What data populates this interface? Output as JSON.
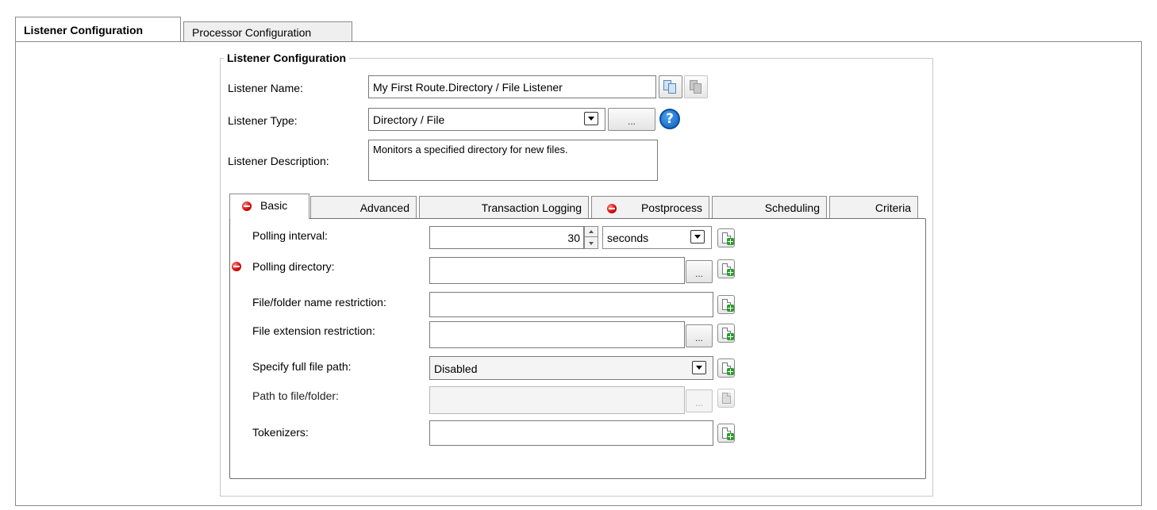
{
  "top_tabs": {
    "listener": "Listener Configuration",
    "processor": "Processor Configuration"
  },
  "group": {
    "title": "Listener Configuration",
    "name_label": "Listener Name:",
    "name_value": "My First Route.Directory / File Listener",
    "type_label": "Listener Type:",
    "type_value": "Directory / File",
    "type_browse": "...",
    "help_icon_text": "?",
    "desc_label": "Listener Description:",
    "desc_value": "Monitors a specified directory for new files."
  },
  "inner_tabs": {
    "basic": "Basic",
    "advanced": "Advanced",
    "transaction_logging": "Transaction Logging",
    "postprocess": "Postprocess",
    "scheduling": "Scheduling",
    "criteria": "Criteria"
  },
  "basic": {
    "polling_interval_label": "Polling interval:",
    "polling_interval_value": "30",
    "polling_interval_unit": "seconds",
    "polling_directory_label": "Polling directory:",
    "polling_directory_value": "",
    "name_restriction_label": "File/folder name restriction:",
    "name_restriction_value": "",
    "ext_restriction_label": "File extension restriction:",
    "ext_restriction_value": "",
    "full_path_label": "Specify full file path:",
    "full_path_value": "Disabled",
    "path_label": "Path to file/folder:",
    "path_value": "",
    "tokenizers_label": "Tokenizers:",
    "tokenizers_value": "",
    "browse": "..."
  },
  "colors": {
    "required_dot": "#d40000",
    "help_blue": "#0f5db8",
    "add_green": "#2e9a2e"
  }
}
